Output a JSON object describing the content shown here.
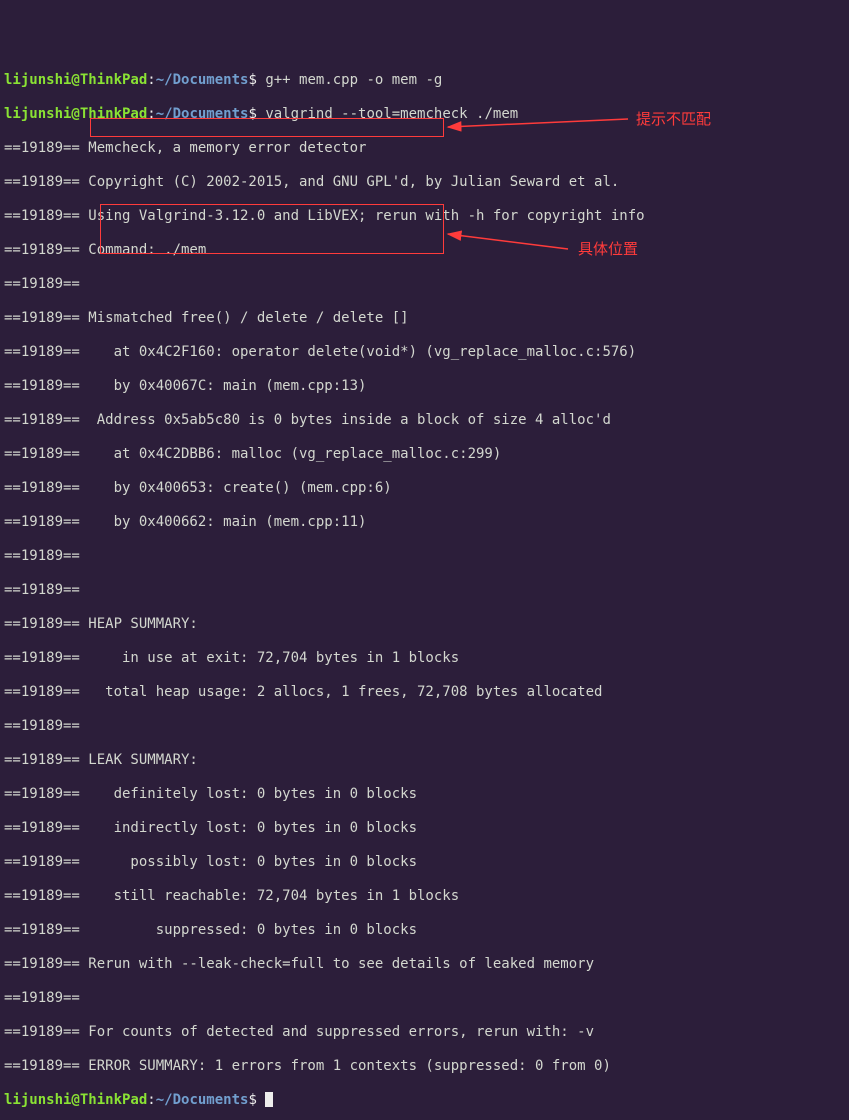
{
  "prompt1": {
    "user": "lijunshi@ThinkPad",
    "sep1": ":",
    "path": "~/Documents",
    "sep2": "$ ",
    "cmd": "g++ mem.cpp -o mem -g"
  },
  "prompt2": {
    "user": "lijunshi@ThinkPad",
    "sep1": ":",
    "path": "~/Documents",
    "sep2": "$ ",
    "cmd": "valgrind --tool=memcheck ./mem"
  },
  "out": {
    "l00": "==19189== Memcheck, a memory error detector",
    "l01": "==19189== Copyright (C) 2002-2015, and GNU GPL'd, by Julian Seward et al.",
    "l02": "==19189== Using Valgrind-3.12.0 and LibVEX; rerun with -h for copyright info",
    "l03": "==19189== Command: ./mem",
    "l04": "==19189== ",
    "l05": "==19189== Mismatched free() / delete / delete []",
    "l06": "==19189==    at 0x4C2F160: operator delete(void*) (vg_replace_malloc.c:576)",
    "l07": "==19189==    by 0x40067C: main (mem.cpp:13)",
    "l08": "==19189==  Address 0x5ab5c80 is 0 bytes inside a block of size 4 alloc'd",
    "l09": "==19189==    at 0x4C2DBB6: malloc (vg_replace_malloc.c:299)",
    "l10": "==19189==    by 0x400653: create() (mem.cpp:6)",
    "l11": "==19189==    by 0x400662: main (mem.cpp:11)",
    "l12": "==19189== ",
    "l13": "==19189== ",
    "l14": "==19189== HEAP SUMMARY:",
    "l15": "==19189==     in use at exit: 72,704 bytes in 1 blocks",
    "l16": "==19189==   total heap usage: 2 allocs, 1 frees, 72,708 bytes allocated",
    "l17": "==19189== ",
    "l18": "==19189== LEAK SUMMARY:",
    "l19": "==19189==    definitely lost: 0 bytes in 0 blocks",
    "l20": "==19189==    indirectly lost: 0 bytes in 0 blocks",
    "l21": "==19189==      possibly lost: 0 bytes in 0 blocks",
    "l22": "==19189==    still reachable: 72,704 bytes in 1 blocks",
    "l23": "==19189==         suppressed: 0 bytes in 0 blocks",
    "l24": "==19189== Rerun with --leak-check=full to see details of leaked memory",
    "l25": "==19189== ",
    "l26": "==19189== For counts of detected and suppressed errors, rerun with: -v",
    "l27": "==19189== ERROR SUMMARY: 1 errors from 1 contexts (suppressed: 0 from 0)"
  },
  "prompt3": {
    "user": "lijunshi@ThinkPad",
    "sep1": ":",
    "path": "~/Documents",
    "sep2": "$ "
  },
  "annotation": {
    "mismatch": "提示不匹配",
    "location": "具体位置"
  }
}
